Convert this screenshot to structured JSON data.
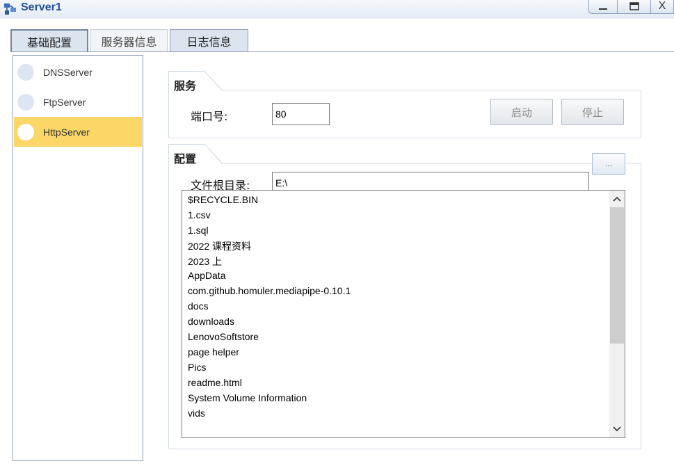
{
  "window": {
    "title": "Server1",
    "minimize_glyph": "_",
    "close_glyph": "X"
  },
  "tabs": [
    {
      "label": "基础配置",
      "active": true
    },
    {
      "label": "服务器信息",
      "active": false
    },
    {
      "label": "日志信息",
      "active": false
    }
  ],
  "servers": [
    {
      "label": "DNSServer",
      "selected": false
    },
    {
      "label": "FtpServer",
      "selected": false
    },
    {
      "label": "HttpServer",
      "selected": true
    }
  ],
  "service": {
    "group_title": "服务",
    "port_label": "端口号:",
    "port_value": "80",
    "start_label": "启动",
    "stop_label": "停止"
  },
  "config": {
    "group_title": "配置",
    "root_label": "文件根目录:",
    "root_value": "E:\\",
    "browse_label": "..."
  },
  "files": [
    "$RECYCLE.BIN",
    "1.csv",
    "1.sql",
    "2022 课程资料",
    "2023 上",
    "AppData",
    "com.github.homuler.mediapipe-0.10.1",
    "docs",
    "downloads",
    "LenovoSoftstore",
    "page helper",
    "Pics",
    "readme.html",
    "System Volume Information",
    "vids"
  ],
  "colors": {
    "selected_item": "#fcd768",
    "title_text": "#1e4e96",
    "tab_bg": "#dbe4ef"
  }
}
